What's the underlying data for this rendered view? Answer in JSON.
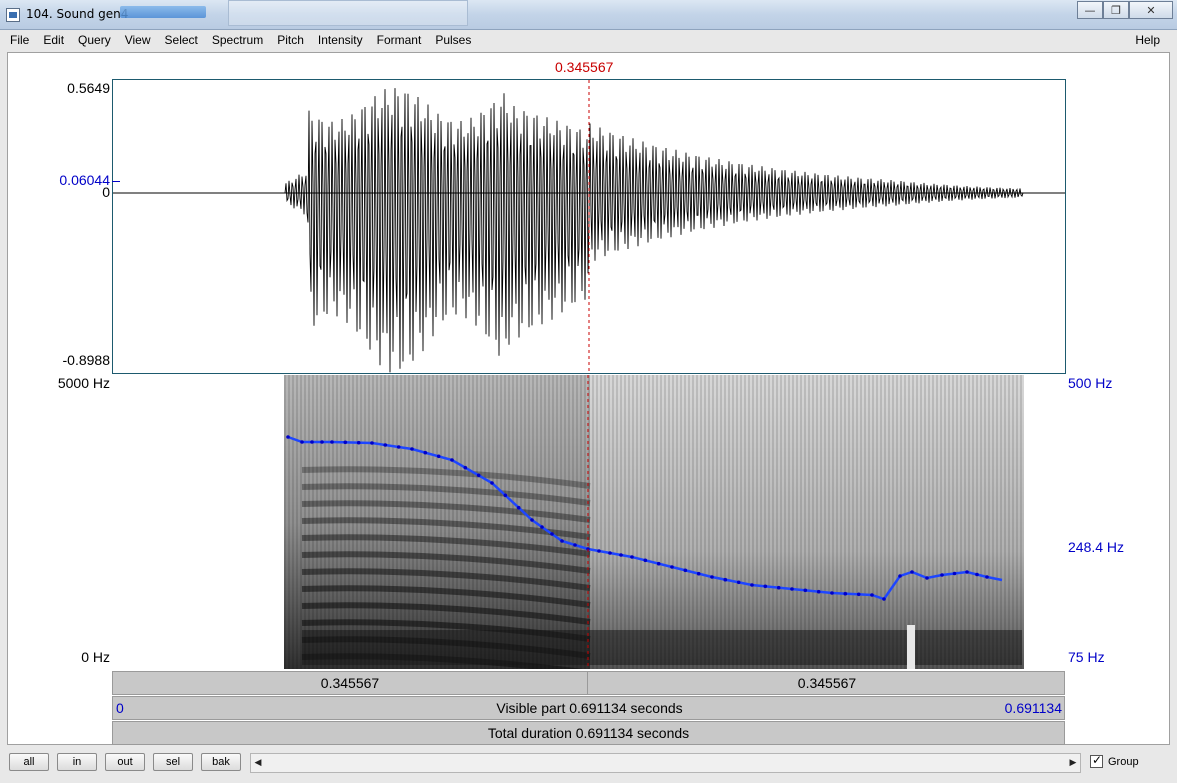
{
  "window": {
    "title": "104. Sound gen4"
  },
  "menu": {
    "items": [
      "File",
      "Edit",
      "Query",
      "View",
      "Select",
      "Spectrum",
      "Pitch",
      "Intensity",
      "Formant",
      "Pulses"
    ],
    "help": "Help"
  },
  "cursor": {
    "time": "0.345567"
  },
  "waveform": {
    "max_label": "0.5649",
    "cursor_value_label": "0.06044",
    "zero_label": "0",
    "min_label": "-0.8988"
  },
  "spectrogram": {
    "top_label": "5000 Hz",
    "bottom_label": "0 Hz",
    "pitch_top_label": "500 Hz",
    "pitch_mid_label": "248.4 Hz",
    "pitch_bottom_label": "75 Hz"
  },
  "timebar": {
    "left_duration": "0.345567",
    "right_duration": "0.345567"
  },
  "visible": {
    "start": "0",
    "text": "Visible part 0.691134 seconds",
    "end": "0.691134"
  },
  "total": {
    "text": "Total duration 0.691134 seconds"
  },
  "nav": {
    "all": "all",
    "in": "in",
    "out": "out",
    "sel": "sel",
    "bak": "bak",
    "group_label": "Group"
  },
  "colors": {
    "cursor": "#c80000",
    "pitch": "#0000c8",
    "pitch_line": "#1e46ff"
  }
}
